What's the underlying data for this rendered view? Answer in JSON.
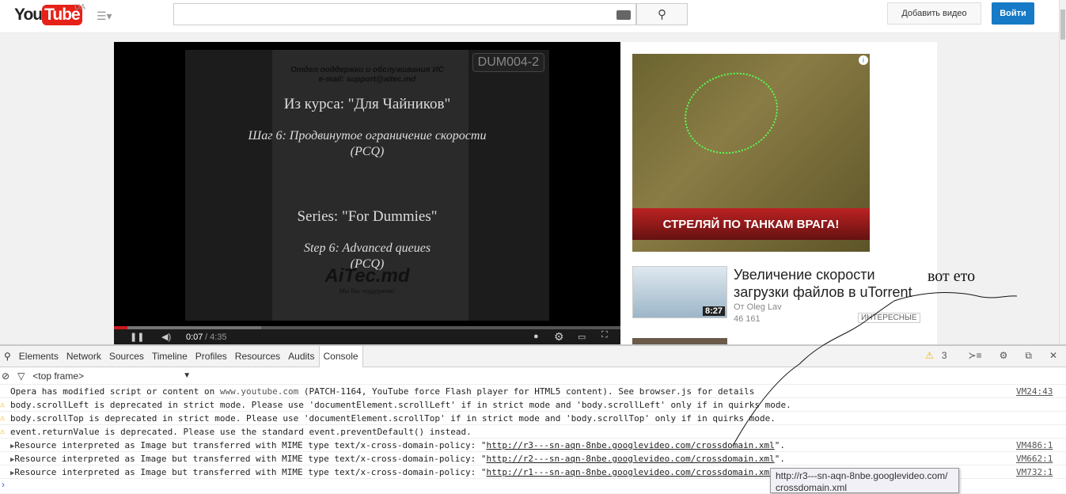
{
  "header": {
    "logo_you": "You",
    "logo_tube": "Tube",
    "region": "UA",
    "search_placeholder": "",
    "upload_label": "Добавить видео",
    "login_label": "Войти"
  },
  "player": {
    "badge": "DUM004-2",
    "line1": "Отдел поддержки и обслуживания ИС",
    "line2": "e-mail: support@aitec.md",
    "line3": "Из курса: \"Для Чайников\"",
    "line4": "Шаг 6: Продвинутое ограничение скорости",
    "line5": "(PCQ)",
    "line6": "Series: \"For Dummies\"",
    "line7": "Step 6: Advanced queues",
    "line8": "(PCQ)",
    "brand": "AiTec.md",
    "slogan": "Мы Вас поддержим!",
    "current_time": "0:07",
    "duration": "/ 4:35",
    "progress_percent": 2.7
  },
  "ad": {
    "banner": "СТРЕЛЯЙ ПО ТАНКАМ ВРАГА!",
    "info": "i"
  },
  "related": {
    "title": "Увеличение скорости загрузки файлов в uTorrent",
    "author": "От Oleg Lav",
    "views": "46 161",
    "duration": "8:27",
    "badge": "ИНТЕРЕСНЫЕ"
  },
  "annotation": "вот ето",
  "devtools": {
    "tabs": [
      "Elements",
      "Network",
      "Sources",
      "Timeline",
      "Profiles",
      "Resources",
      "Audits",
      "Console"
    ],
    "warning_count": "3",
    "frame": "<top frame>",
    "messages": [
      {
        "pre": "Opera has modified script or content on ",
        "host": "www.youtube.com",
        "post": " (PATCH-1164, YouTube force Flash player for HTML5 content). See browser.js for details",
        "src": "VM24:43"
      },
      {
        "text": "body.scrollLeft is deprecated in strict mode. Please use 'documentElement.scrollLeft' if in strict mode and 'body.scrollLeft' only if in quirks mode."
      },
      {
        "text": "body.scrollTop is deprecated in strict mode. Please use 'documentElement.scrollTop' if in strict mode and 'body.scrollTop' only if in quirks mode."
      },
      {
        "text": "event.returnValue is deprecated. Please use the standard event.preventDefault() instead."
      },
      {
        "pre": "Resource interpreted as Image but transferred with MIME type text/x-cross-domain-policy: \"",
        "url": "http://r3---sn-aqn-8nbe.googlevideo.com/crossdomain.xml",
        "post": "\".",
        "src": "VM486:1"
      },
      {
        "pre": "Resource interpreted as Image but transferred with MIME type text/x-cross-domain-policy: \"",
        "url": "http://r2---sn-aqn-8nbe.googlevideo.com/crossdomain.xml",
        "post": "\".",
        "src": "VM662:1"
      },
      {
        "pre": "Resource interpreted as Image but transferred with MIME type text/x-cross-domain-policy: \"",
        "url": "http://r1---sn-aqn-8nbe.googlevideo.com/crossdomain.xml",
        "post": "\".",
        "src": "VM732:1"
      }
    ],
    "tooltip_line1": "http://r3---sn-aqn-8nbe.googlevideo.com/",
    "tooltip_line2": "crossdomain.xml"
  }
}
